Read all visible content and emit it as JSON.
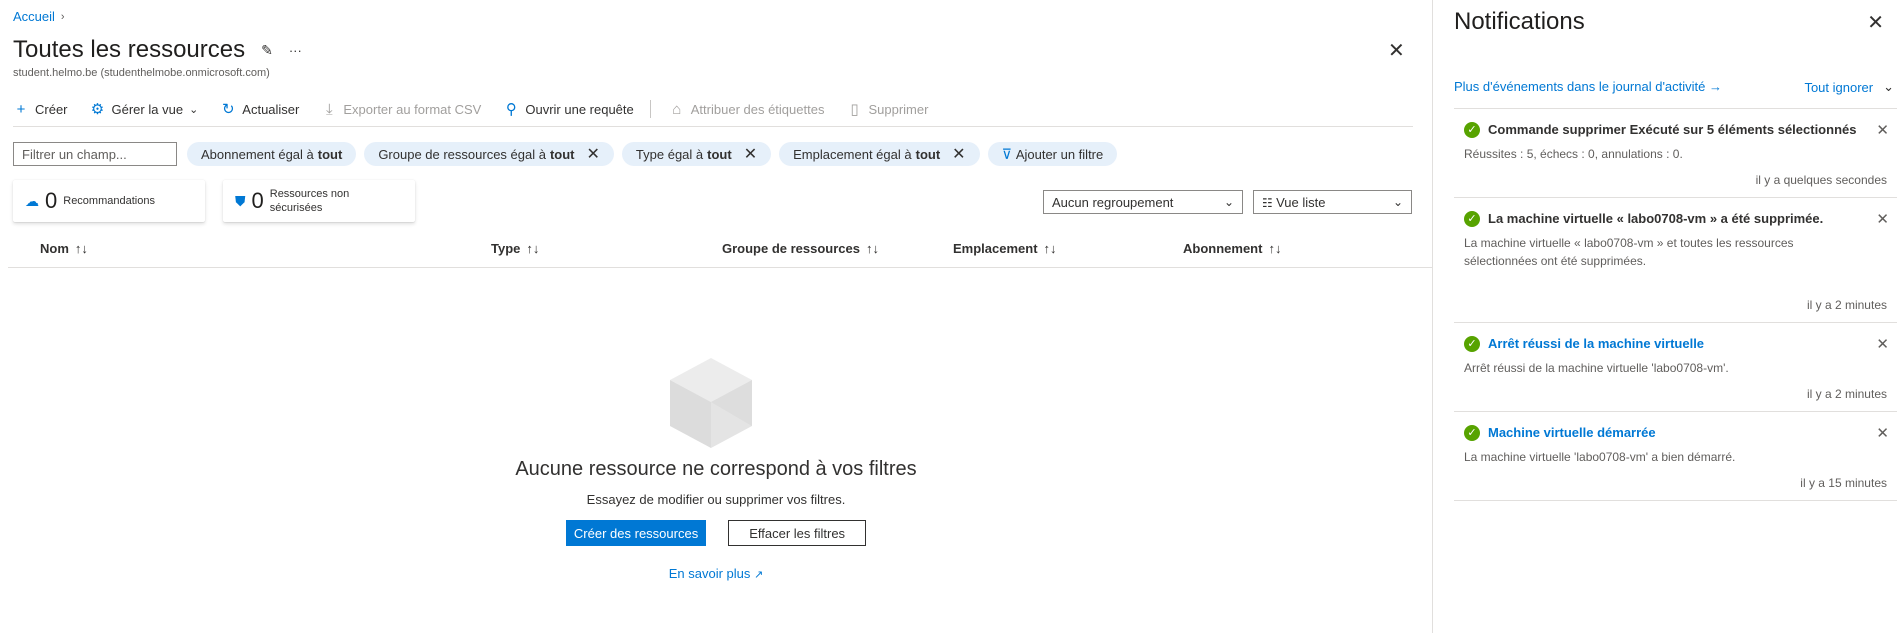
{
  "breadcrumb": {
    "home": "Accueil",
    "chevron": "›"
  },
  "page": {
    "title": "Toutes les ressources",
    "subtitle": "student.helmo.be (studenthelmobe.onmicrosoft.com)",
    "pin_icon": "✎",
    "more_icon": "···",
    "close_icon": "✕"
  },
  "toolbar": {
    "create": "Créer",
    "manage_view": "Gérer la vue",
    "refresh": "Actualiser",
    "export_csv": "Exporter au format CSV",
    "open_query": "Ouvrir une requête",
    "assign_tags": "Attribuer des étiquettes",
    "delete": "Supprimer"
  },
  "filters": {
    "placeholder": "Filtrer un champ...",
    "pills": [
      {
        "label": "Abonnement égal à ",
        "value": "tout"
      },
      {
        "label": "Groupe de ressources égal à ",
        "value": "tout"
      },
      {
        "label": "Type égal à ",
        "value": "tout"
      },
      {
        "label": "Emplacement égal à ",
        "value": "tout"
      }
    ],
    "add_filter": "Ajouter un filtre"
  },
  "cards": {
    "recommendations": {
      "count": "0",
      "label": "Recommandations"
    },
    "unsecured": {
      "count": "0",
      "label_line1": "Ressources non",
      "label_line2": "sécurisées"
    }
  },
  "view": {
    "grouping": "Aucun regroupement",
    "list_view": "Vue liste"
  },
  "table": {
    "columns": [
      "Nom",
      "Type",
      "Groupe de ressources",
      "Emplacement",
      "Abonnement"
    ]
  },
  "empty_state": {
    "title": "Aucune ressource ne correspond à vos filtres",
    "subtitle": "Essayez de modifier ou supprimer vos filtres.",
    "create_button": "Créer des ressources",
    "clear_button": "Effacer les filtres",
    "learn_more": "En savoir plus"
  },
  "notifications": {
    "title": "Notifications",
    "activity_log_link": "Plus d'événements dans le journal d'activité →",
    "dismiss_all": "Tout ignorer",
    "items": [
      {
        "title": "Commande supprimer Exécuté sur 5 éléments sélectionnés",
        "body": "Réussites : 5, échecs : 0, annulations : 0.",
        "time": "il y a quelques secondes",
        "is_link": false
      },
      {
        "title": "La machine virtuelle « labo0708-vm » a été supprimée.",
        "body": "La machine virtuelle « labo0708-vm » et toutes les ressources sélectionnées ont été supprimées.",
        "time": "il y a 2 minutes",
        "is_link": false
      },
      {
        "title": "Arrêt réussi de la machine virtuelle",
        "body": "Arrêt réussi de la machine virtuelle 'labo0708-vm'.",
        "time": "il y a 2 minutes",
        "is_link": true
      },
      {
        "title": "Machine virtuelle démarrée",
        "body": "La machine virtuelle 'labo0708-vm' a bien démarré.",
        "time": "il y a 15 minutes",
        "is_link": true
      }
    ]
  }
}
